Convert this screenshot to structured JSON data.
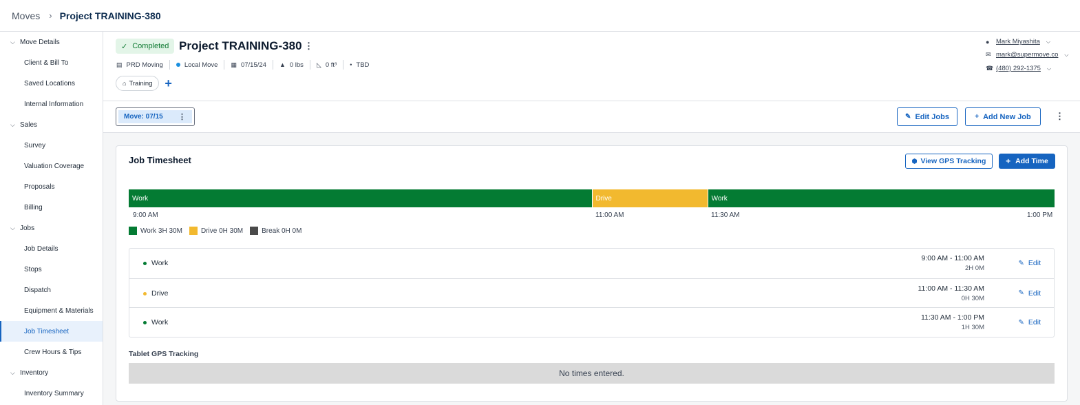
{
  "breadcrumb": {
    "root": "Moves",
    "current": "Project TRAINING-380"
  },
  "sidebar": {
    "groups": [
      {
        "label": "Move Details",
        "items": [
          "Client & Bill To",
          "Saved Locations",
          "Internal Information"
        ]
      },
      {
        "label": "Sales",
        "items": [
          "Survey",
          "Valuation Coverage",
          "Proposals",
          "Billing"
        ]
      },
      {
        "label": "Jobs",
        "items": [
          "Job Details",
          "Stops",
          "Dispatch",
          "Equipment & Materials",
          "Job Timesheet",
          "Crew Hours & Tips"
        ]
      },
      {
        "label": "Inventory",
        "items": [
          "Inventory Summary"
        ]
      }
    ],
    "active": "Job Timesheet"
  },
  "header": {
    "status": "Completed",
    "title": "Project TRAINING-380",
    "meta": {
      "company": "PRD Moving",
      "move_type": "Local Move",
      "date": "07/15/24",
      "weight": "0 lbs",
      "volume": "0 ft³",
      "location": "TBD"
    },
    "tag": "Training",
    "contact": {
      "name": "Mark Miyashita",
      "email": "mark@supermove.co",
      "phone": "(480) 292-1375"
    }
  },
  "jobbar": {
    "move_tab": "Move: 07/15",
    "edit_jobs": "Edit Jobs",
    "add_new_job": "Add New Job"
  },
  "timesheet": {
    "title": "Job Timesheet",
    "view_gps": "View GPS Tracking",
    "add_time": "Add Time",
    "segments": [
      {
        "label": "Work",
        "minutes": 120,
        "color": "#047b33"
      },
      {
        "label": "Drive",
        "minutes": 30,
        "color": "#f2b92f"
      },
      {
        "label": "Work",
        "minutes": 90,
        "color": "#047b33"
      }
    ],
    "ticks": [
      "9:00 AM",
      "11:00 AM",
      "11:30 AM",
      "1:00 PM"
    ],
    "legend": [
      {
        "label": "Work 3H 30M",
        "color": "#047b33"
      },
      {
        "label": "Drive 0H 30M",
        "color": "#f2b92f"
      },
      {
        "label": "Break 0H 0M",
        "color": "#4a4a4a"
      }
    ],
    "entries": [
      {
        "label": "Work",
        "range": "9:00 AM - 11:00 AM",
        "duration": "2H 0M",
        "color": "#047b33",
        "edit": "Edit"
      },
      {
        "label": "Drive",
        "range": "11:00 AM - 11:30 AM",
        "duration": "0H 30M",
        "color": "#f2b92f",
        "edit": "Edit"
      },
      {
        "label": "Work",
        "range": "11:30 AM - 1:00 PM",
        "duration": "1H 30M",
        "color": "#047b33",
        "edit": "Edit"
      }
    ],
    "gps_title": "Tablet GPS Tracking",
    "gps_empty": "No times entered."
  }
}
